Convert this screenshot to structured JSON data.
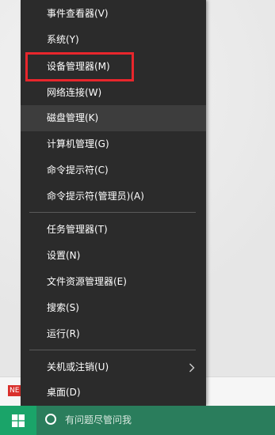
{
  "menu": {
    "items": [
      {
        "label": "事件查看器(V)"
      },
      {
        "label": "系统(Y)"
      },
      {
        "label": "设备管理器(M)"
      },
      {
        "label": "网络连接(W)"
      },
      {
        "label": "磁盘管理(K)"
      },
      {
        "label": "计算机管理(G)"
      },
      {
        "label": "命令提示符(C)"
      },
      {
        "label": "命令提示符(管理员)(A)"
      },
      {
        "label": "任务管理器(T)"
      },
      {
        "label": "设置(N)"
      },
      {
        "label": "文件资源管理器(E)"
      },
      {
        "label": "搜索(S)"
      },
      {
        "label": "运行(R)"
      },
      {
        "label": "关机或注销(U)"
      },
      {
        "label": "桌面(D)"
      }
    ],
    "hovered_item": "磁盘管理(K)",
    "highlighted_item": "设备管理器(M)"
  },
  "background": {
    "badge_text": "NE"
  },
  "taskbar": {
    "search_placeholder": "有问题尽管问我",
    "start_icon": "windows-logo-icon",
    "search_icon": "cortana-ring-icon",
    "accent_color": "#1aa469"
  },
  "colors": {
    "menu_bg": "#2b2b2b",
    "highlight_border": "#e8262c"
  }
}
